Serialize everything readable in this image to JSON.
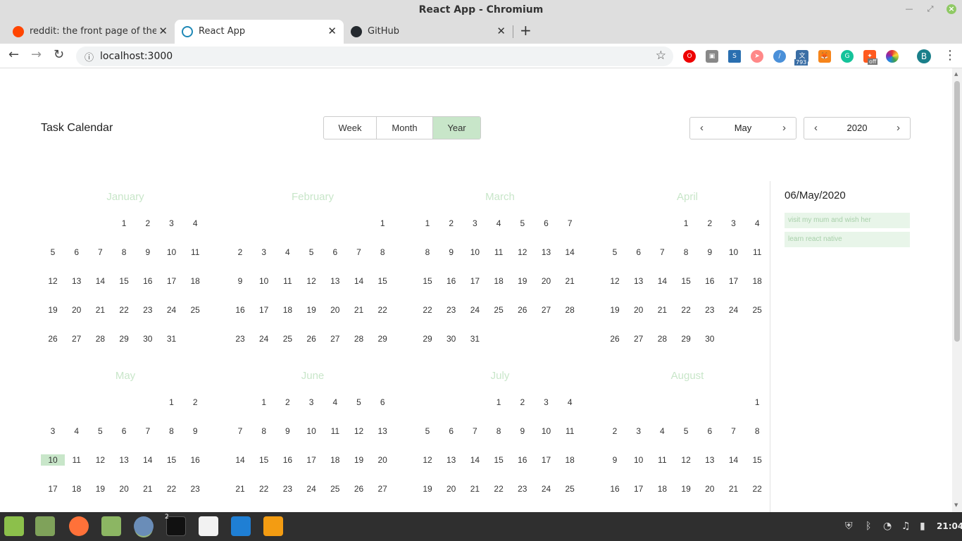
{
  "window": {
    "title": "React App - Chromium"
  },
  "tabs": [
    {
      "label": "reddit: the front page of the inte",
      "favicon": "reddit-icon"
    },
    {
      "label": "React App",
      "favicon": "react-icon"
    },
    {
      "label": "GitHub",
      "favicon": "github-icon"
    }
  ],
  "toolbar": {
    "url": "localhost:3000",
    "profile_initial": "B",
    "badge_count": "793",
    "badge_off": "off"
  },
  "app": {
    "title": "Task Calendar",
    "views": [
      "Week",
      "Month",
      "Year"
    ],
    "active_view": "Year",
    "month_picker": "May",
    "year_picker": "2020",
    "accent": "#c8e6c9"
  },
  "calendar": {
    "year": 2020,
    "today": {
      "month": 4,
      "day": 10
    },
    "months": [
      "January",
      "February",
      "March",
      "April",
      "May",
      "June",
      "July",
      "August"
    ]
  },
  "sidebar": {
    "date": "06/May/2020",
    "tasks": [
      "visit my mum and wish her",
      "learn react native"
    ]
  },
  "taskbar": {
    "clock": "21:04",
    "terminal_badge": "2"
  }
}
